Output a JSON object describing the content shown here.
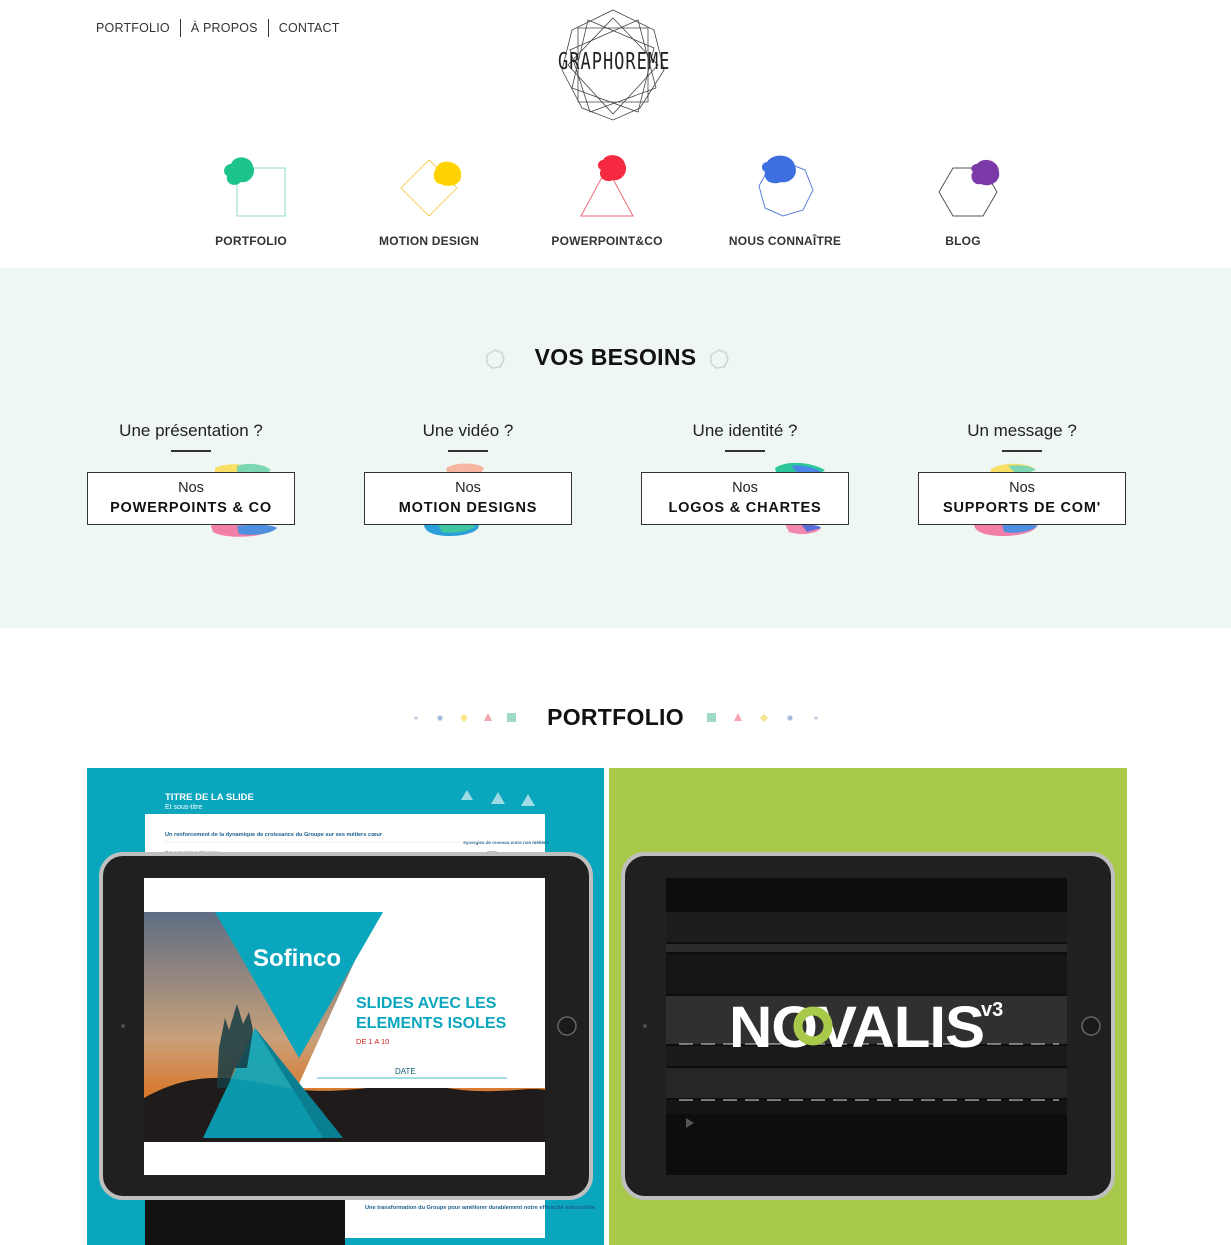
{
  "topnav": {
    "items": [
      "PORTFOLIO",
      "À PROPOS",
      "CONTACT"
    ]
  },
  "logo": {
    "text": "GRAPHOREME"
  },
  "categories": [
    {
      "label": "PORTFOLIO",
      "color": "#1cc38a",
      "shape": "square"
    },
    {
      "label": "MOTION DESIGN",
      "color": "#ffd200",
      "shape": "diamond"
    },
    {
      "label": "POWERPOINT&CO",
      "color": "#f5293f",
      "shape": "triangle"
    },
    {
      "label": "NOUS CONNAÎTRE",
      "color": "#3e6fe0",
      "shape": "heptagon"
    },
    {
      "label": "BLOG",
      "color": "#7b3aa8",
      "shape": "hexagon"
    }
  ],
  "besoins": {
    "title": "VOS BESOINS",
    "items": [
      {
        "question": "Une présentation ?",
        "prefix": "Nos",
        "label": "POWERPOINTS & CO"
      },
      {
        "question": "Une vidéo ?",
        "prefix": "Nos",
        "label": "MOTION DESIGNS"
      },
      {
        "question": "Une identité ?",
        "prefix": "Nos",
        "label": "LOGOS & CHARTES"
      },
      {
        "question": "Un message ?",
        "prefix": "Nos",
        "label": "SUPPORTS DE COM'"
      }
    ]
  },
  "portfolio": {
    "title": "PORTFOLIO",
    "tiles": [
      {
        "bg": "#0aa6bd",
        "slide_title": "TITRE DE LA SLIDE",
        "slide_subtitle": "Et sous-titre",
        "slide_body": "Un renforcement de la dynamique de croissance du Groupe sur ses métiers cœur",
        "slide_small": "Des synergies portées par :",
        "slide_side": "Synergies de revenus entre nos métiers",
        "slide_year": "2016",
        "brand": "Sofinco",
        "headline_1": "SLIDES AVEC LES",
        "headline_2": "ELEMENTS ISOLES",
        "range": "DE 1 A 10",
        "date": "DATE",
        "footer": "Une transformation du Groupe pour améliorer durablement notre efficacité industrielle"
      },
      {
        "bg": "#a8c94a",
        "brand": "NOVALIS",
        "sup": "v3"
      }
    ]
  }
}
